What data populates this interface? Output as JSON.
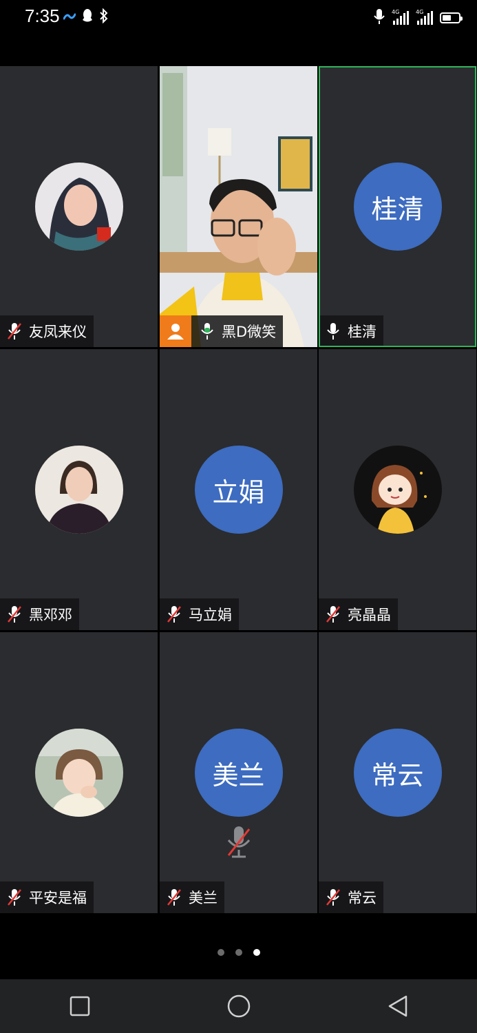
{
  "status_bar": {
    "time": "7:35",
    "left_icons": [
      "meeting-app-icon",
      "qq-icon",
      "bluetooth-icon"
    ],
    "right_icons": [
      "microphone-icon",
      "signal-4g-icon",
      "signal-4g-icon",
      "battery-icon"
    ],
    "network_label_1": "4G",
    "network_label_2": "4G",
    "battery_level": 0.55
  },
  "participants": [
    {
      "name": "友凤来仪",
      "mic": "muted",
      "avatar": "photo-woman-scarf",
      "video": false,
      "active": false
    },
    {
      "name": "黑D微笑",
      "mic": "speaking",
      "avatar": "video-feed",
      "video": true,
      "active": false,
      "host": true
    },
    {
      "name": "桂清",
      "mic": "on",
      "initials": "桂清",
      "video": false,
      "active": true
    },
    {
      "name": "黑邓邓",
      "mic": "muted",
      "avatar": "photo-woman-dark-top",
      "video": false,
      "active": false
    },
    {
      "name": "马立娟",
      "mic": "muted",
      "initials": "立娟",
      "video": false,
      "active": false
    },
    {
      "name": "亮晶晶",
      "mic": "muted",
      "avatar": "cartoon-girl-avatar",
      "video": false,
      "active": false
    },
    {
      "name": "平安是福",
      "mic": "muted",
      "avatar": "photo-little-girl",
      "video": false,
      "active": false
    },
    {
      "name": "美兰",
      "mic": "muted",
      "initials": "美兰",
      "video": false,
      "active": false,
      "center_muted_icon": true
    },
    {
      "name": "常云",
      "mic": "muted",
      "initials": "常云",
      "video": false,
      "active": false
    }
  ],
  "pager": {
    "total": 3,
    "current": 3
  },
  "nav": [
    "recent-apps-button",
    "home-button",
    "back-button"
  ],
  "colors": {
    "tile_bg": "#2b2c2f",
    "initials_bg": "#3d6cc0",
    "active_border": "#2fb55b",
    "host_badge": "#f07b1a",
    "mute_slash": "#e53935"
  }
}
